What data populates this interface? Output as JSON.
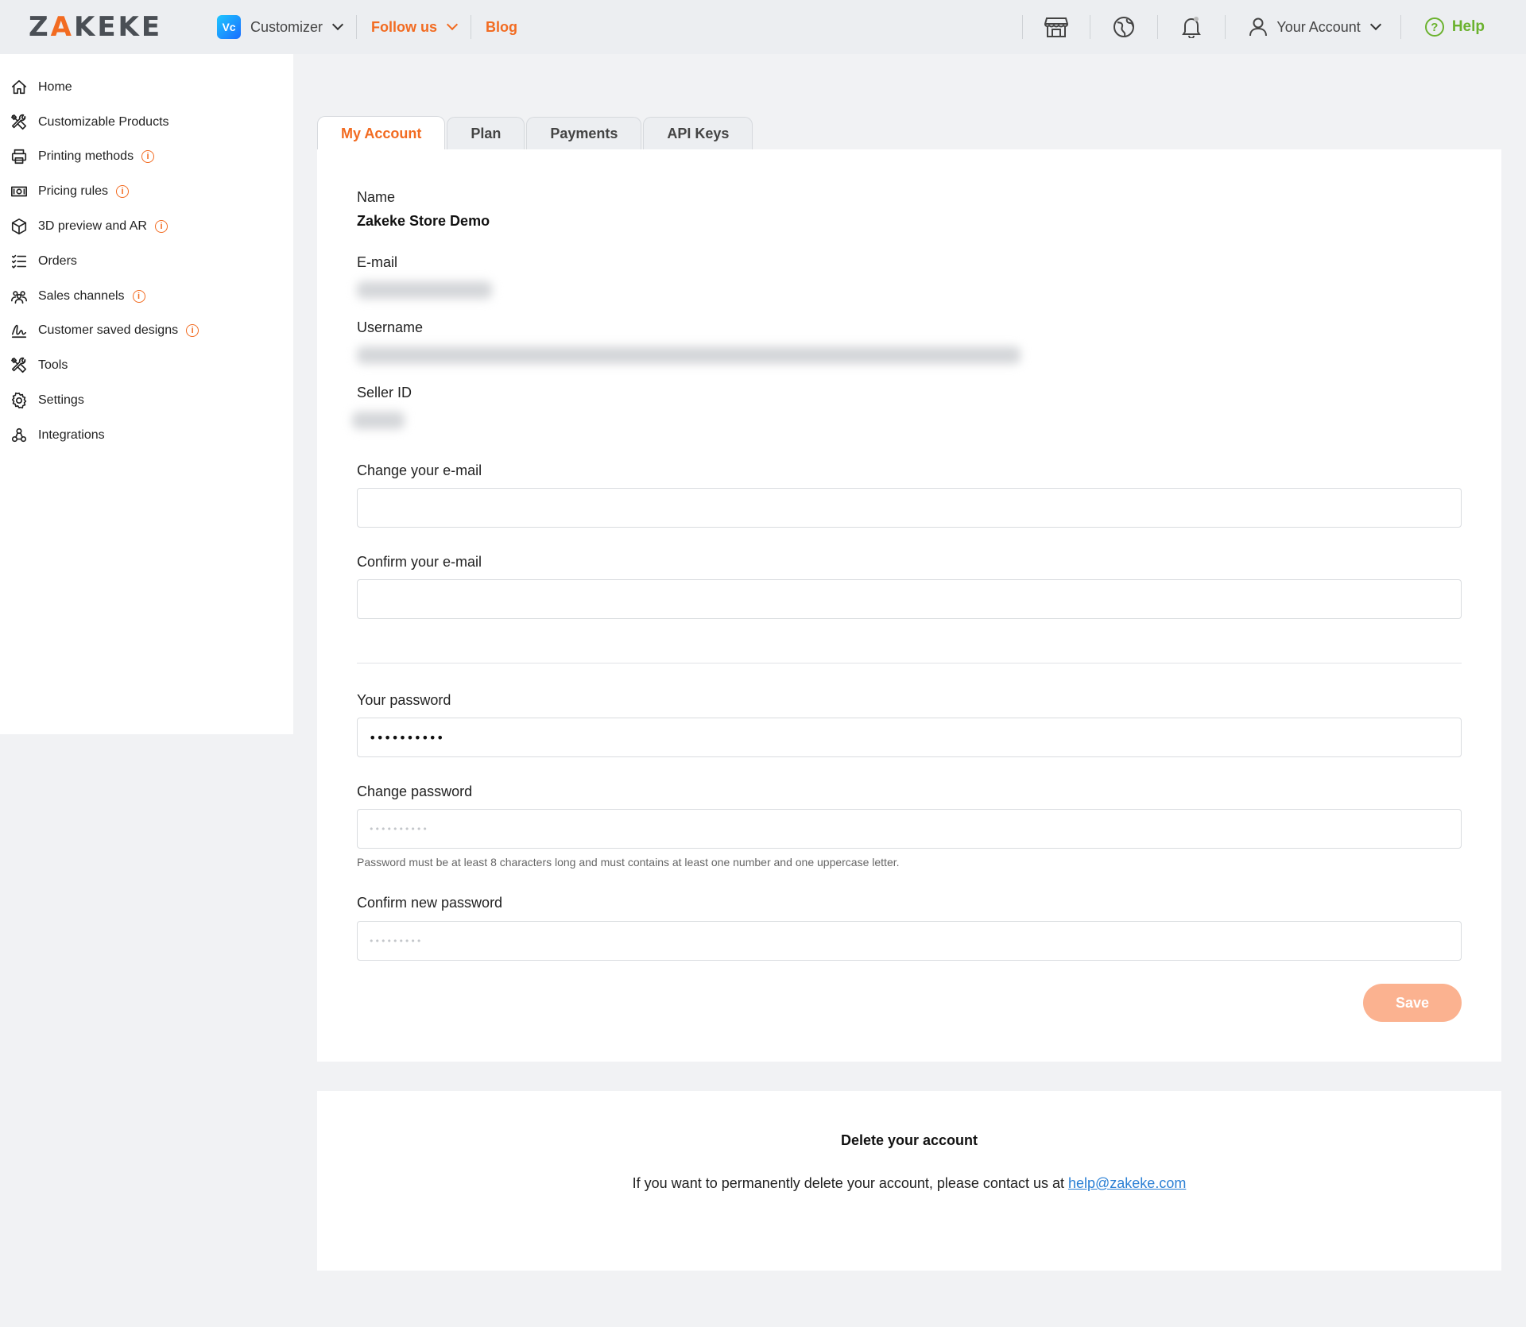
{
  "header": {
    "logo": {
      "left": "Z",
      "accent": "A",
      "right": "KEKE"
    },
    "product": {
      "badge": "Vc",
      "label": "Customizer"
    },
    "follow_us": "Follow us",
    "blog": "Blog",
    "icons": [
      "store-icon",
      "globe-icon",
      "bell-icon"
    ],
    "account_label": "Your Account",
    "help_label": "Help"
  },
  "sidebar": {
    "items": [
      {
        "label": "Home",
        "icon": "home-icon",
        "info": false
      },
      {
        "label": "Customizable Products",
        "icon": "tools-icon",
        "info": false
      },
      {
        "label": "Printing methods",
        "icon": "printer-icon",
        "info": true
      },
      {
        "label": "Pricing rules",
        "icon": "money-icon",
        "info": true
      },
      {
        "label": "3D preview and AR",
        "icon": "cube-icon",
        "info": true
      },
      {
        "label": "Orders",
        "icon": "list-icon",
        "info": false
      },
      {
        "label": "Sales channels",
        "icon": "people-icon",
        "info": true
      },
      {
        "label": "Customer saved designs",
        "icon": "signature-icon",
        "info": true
      },
      {
        "label": "Tools",
        "icon": "tools-icon",
        "info": false
      },
      {
        "label": "Settings",
        "icon": "gear-icon",
        "info": false
      },
      {
        "label": "Integrations",
        "icon": "integrations-icon",
        "info": false
      }
    ],
    "info_glyph": "i"
  },
  "tabs": [
    {
      "label": "My Account",
      "active": true
    },
    {
      "label": "Plan",
      "active": false
    },
    {
      "label": "Payments",
      "active": false
    },
    {
      "label": "API Keys",
      "active": false
    }
  ],
  "account": {
    "name_label": "Name",
    "name_value": "Zakeke Store Demo",
    "email_label": "E-mail",
    "username_label": "Username",
    "seller_label": "Seller ID",
    "change_email_label": "Change your e-mail",
    "confirm_email_label": "Confirm your e-mail",
    "password_label": "Your password",
    "password_value": "••••••••••",
    "change_password_label": "Change password",
    "change_password_placeholder": "••••••••••",
    "password_hint": "Password must be at least 8 characters long and must contains at least one number and one uppercase letter.",
    "confirm_password_label": "Confirm new password",
    "confirm_password_placeholder": "•••••••••",
    "save_label": "Save"
  },
  "delete": {
    "title": "Delete your account",
    "text": "If you want to permanently delete your account, please contact us at ",
    "email": "help@zakeke.com"
  },
  "colors": {
    "accent": "#f26b21",
    "help": "#6bb22e",
    "save": "#fbb290",
    "link": "#2a7fd4"
  }
}
